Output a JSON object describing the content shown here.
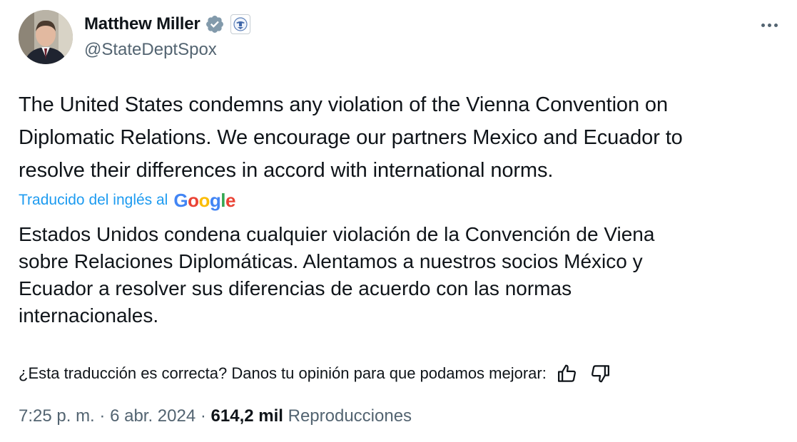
{
  "author": {
    "display_name": "Matthew Miller",
    "handle": "@StateDeptSpox",
    "verified_badge": "verified-badge-icon",
    "affiliation_badge": "us-state-dept-seal-icon"
  },
  "menu": {
    "more_icon": "more-options-icon"
  },
  "tweet": {
    "lines": [
      "The United States condemns any violation of the Vienna Convention on",
      "Diplomatic Relations. We encourage our partners Mexico and Ecuador to",
      "resolve their differences in accord with international norms."
    ]
  },
  "translation": {
    "label": "Traducido del inglés al",
    "provider": "Google",
    "lines": [
      "Estados Unidos condena cualquier violación de la Convención de Viena",
      "sobre Relaciones Diplomáticas. Alentamos a nuestros socios México y",
      "Ecuador a resolver sus diferencias de acuerdo con las normas",
      "internacionales."
    ]
  },
  "feedback": {
    "question": "¿Esta traducción es correcta? Danos tu opinión para que podamos mejorar:",
    "thumbs_up_icon": "thumbs-up-icon",
    "thumbs_down_icon": "thumbs-down-icon"
  },
  "meta": {
    "time": "7:25 p. m.",
    "separator": "·",
    "date": "6 abr. 2024",
    "views_count": "614,2 mil",
    "views_label": "Reproducciones"
  },
  "colors": {
    "link_blue": "#1d9bf0",
    "text_primary": "#0f1419",
    "text_secondary": "#536471",
    "verified_gray": "#829aab"
  }
}
